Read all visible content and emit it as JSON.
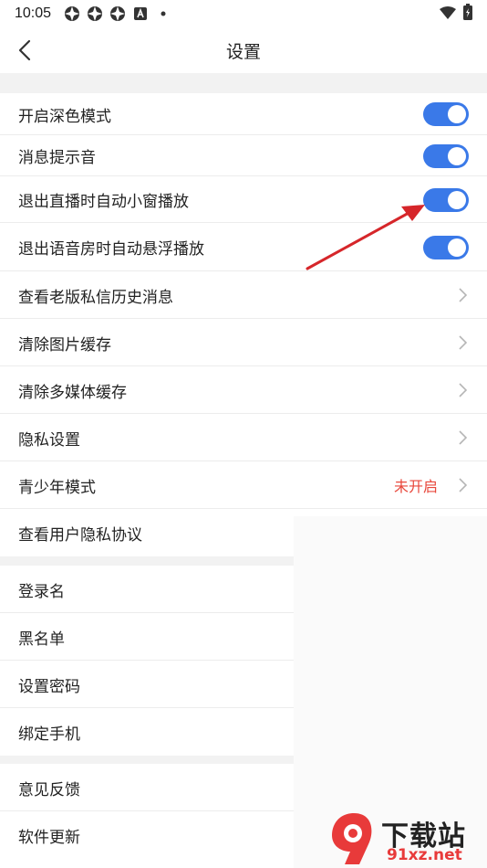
{
  "status_bar": {
    "time": "10:05",
    "icons": [
      "app-icon",
      "app-icon",
      "app-icon",
      "letter-a-icon",
      "dot-icon"
    ],
    "right_icons": [
      "wifi-icon",
      "battery-icon"
    ]
  },
  "header": {
    "title": "设置"
  },
  "sections": [
    {
      "items": [
        {
          "label": "开启深色模式",
          "type": "toggle",
          "on": true
        },
        {
          "label": "消息提示音",
          "type": "toggle",
          "on": true
        },
        {
          "label": "退出直播时自动小窗播放",
          "type": "toggle",
          "on": true
        },
        {
          "label": "退出语音房时自动悬浮播放",
          "type": "toggle",
          "on": true
        },
        {
          "label": "查看老版私信历史消息",
          "type": "link"
        },
        {
          "label": "清除图片缓存",
          "type": "link"
        },
        {
          "label": "清除多媒体缓存",
          "type": "link"
        },
        {
          "label": "隐私设置",
          "type": "link"
        },
        {
          "label": "青少年模式",
          "type": "link",
          "value": "未开启"
        },
        {
          "label": "查看用户隐私协议",
          "type": "link"
        }
      ]
    },
    {
      "items": [
        {
          "label": "登录名",
          "type": "plain"
        },
        {
          "label": "黑名单",
          "type": "plain"
        },
        {
          "label": "设置密码",
          "type": "plain"
        },
        {
          "label": "绑定手机",
          "type": "plain"
        }
      ]
    },
    {
      "items": [
        {
          "label": "意见反馈",
          "type": "plain"
        },
        {
          "label": "软件更新",
          "type": "plain"
        }
      ]
    }
  ],
  "watermark": {
    "text_main": "下载站",
    "text_url": "91xz.net"
  },
  "colors": {
    "toggle_on": "#3a79e8",
    "value_red": "#e8483c",
    "arrow": "#d6262a",
    "section_gap": "#f2f2f2"
  }
}
